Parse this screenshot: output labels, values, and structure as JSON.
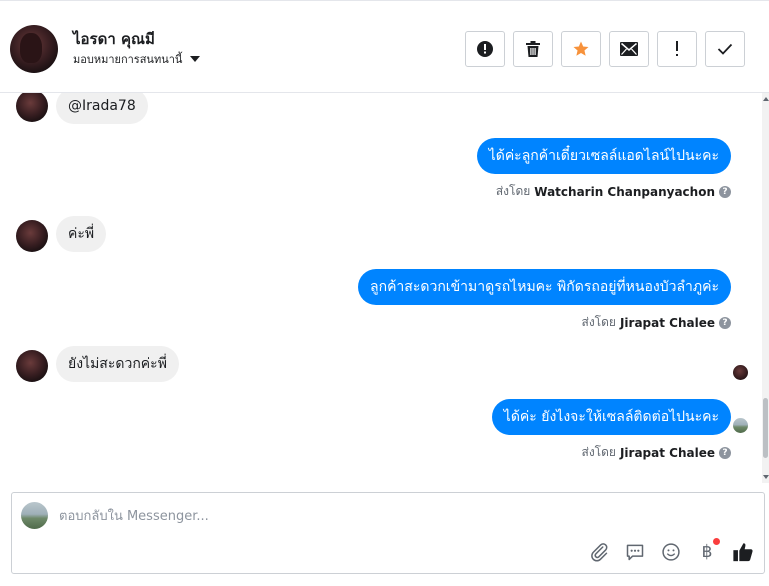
{
  "header": {
    "contact_name": "ไอรดา คุณมี",
    "assign_label": "มอบหมายการสนทนานี้",
    "actions": [
      {
        "name": "spam-button",
        "icon": "alert-circle-icon"
      },
      {
        "name": "delete-button",
        "icon": "trash-icon"
      },
      {
        "name": "star-button",
        "icon": "star-icon"
      },
      {
        "name": "mark-unread-button",
        "icon": "envelope-icon"
      },
      {
        "name": "follow-up-button",
        "icon": "exclamation-icon"
      },
      {
        "name": "mark-done-button",
        "icon": "checkmark-icon"
      }
    ]
  },
  "messages": [
    {
      "direction": "in",
      "text": "@Irada78"
    },
    {
      "direction": "out",
      "text": "ได้ค่ะลูกค้าเดี๋ยวเซลล์แอดไลน์ไปนะคะ",
      "sent_by_label": "ส่งโดย",
      "sender": "Watcharin Chanpanyachon"
    },
    {
      "direction": "in",
      "text": "ค่ะพี่"
    },
    {
      "direction": "out",
      "text": "ลูกค้าสะดวกเข้ามาดูรถไหมคะ พิกัดรถอยู่ที่หนองบัวลำภูค่ะ",
      "sent_by_label": "ส่งโดย",
      "sender": "Jirapat Chalee"
    },
    {
      "direction": "in",
      "text": "ยังไม่สะดวกค่ะพี่"
    },
    {
      "direction": "out",
      "text": "ได้ค่ะ ยังไงจะให้เซลล์ติดต่อไปนะคะ",
      "sent_by_label": "ส่งโดย",
      "sender": "Jirapat Chalee"
    }
  ],
  "composer": {
    "placeholder": "ตอบกลับใน Messenger...",
    "currency_symbol": "฿"
  },
  "colors": {
    "outgoing_bubble": "#0084ff",
    "incoming_bubble": "#f0f0f0",
    "star": "#f7923b"
  }
}
